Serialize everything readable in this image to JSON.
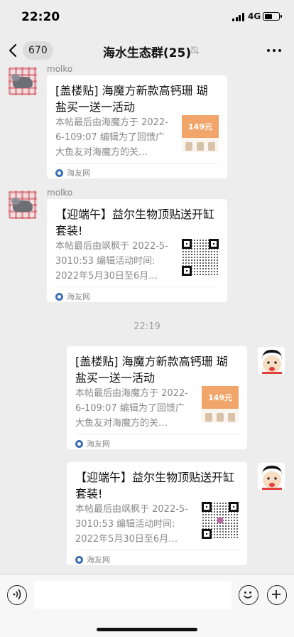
{
  "status_bar": {
    "time": "22:20",
    "network": "4G"
  },
  "nav": {
    "unread_count": "670",
    "title": "海水生态群(25)"
  },
  "messages": [
    {
      "sender": "molko",
      "title": "[盖楼贴] 海魔方新款高钙珊 瑚盐买一送一活动",
      "desc": "本帖最后由海魔方于 2022-6-109:07 编辑为了回馈广大鱼友对海魔方的关…",
      "source": "海友网",
      "thumb": {
        "kind": "promo",
        "price_text": "149元"
      }
    },
    {
      "sender": "molko",
      "title": "【迎端午】益尔生物顶贴送开缸套装!",
      "desc": "本帖最后由飒枫于 2022-5-3010:53 编辑活动时间: 2022年5月30日至6月…",
      "source": "海友网",
      "thumb": {
        "kind": "qr"
      }
    }
  ],
  "timestamp": "22:19",
  "my_messages": [
    {
      "title": "[盖楼贴] 海魔方新款高钙珊 瑚盐买一送一活动",
      "desc": "本帖最后由海魔方于 2022-6-109:07 编辑为了回馈广大鱼友对海魔方的关…",
      "source": "海友网",
      "thumb": {
        "kind": "promo",
        "price_text": "149元"
      }
    },
    {
      "title": "【迎端午】益尔生物顶贴送开缸套装!",
      "desc": "本帖最后由飒枫于 2022-5-3010:53 编辑活动时间: 2022年5月30日至6月…",
      "source": "海友网",
      "thumb": {
        "kind": "qr"
      }
    }
  ],
  "icons": {
    "back": "chevron-left-icon",
    "mute": "bell-off-icon",
    "more": "ellipsis-icon",
    "voice": "voice-icon",
    "emoji": "emoji-icon",
    "add": "plus-icon",
    "source_logo": "haiyou-logo-icon"
  },
  "colors": {
    "background": "#ededed",
    "bubble": "#ffffff",
    "badge": "#dcdcdc",
    "promo_thumb": "#f1a56a"
  }
}
